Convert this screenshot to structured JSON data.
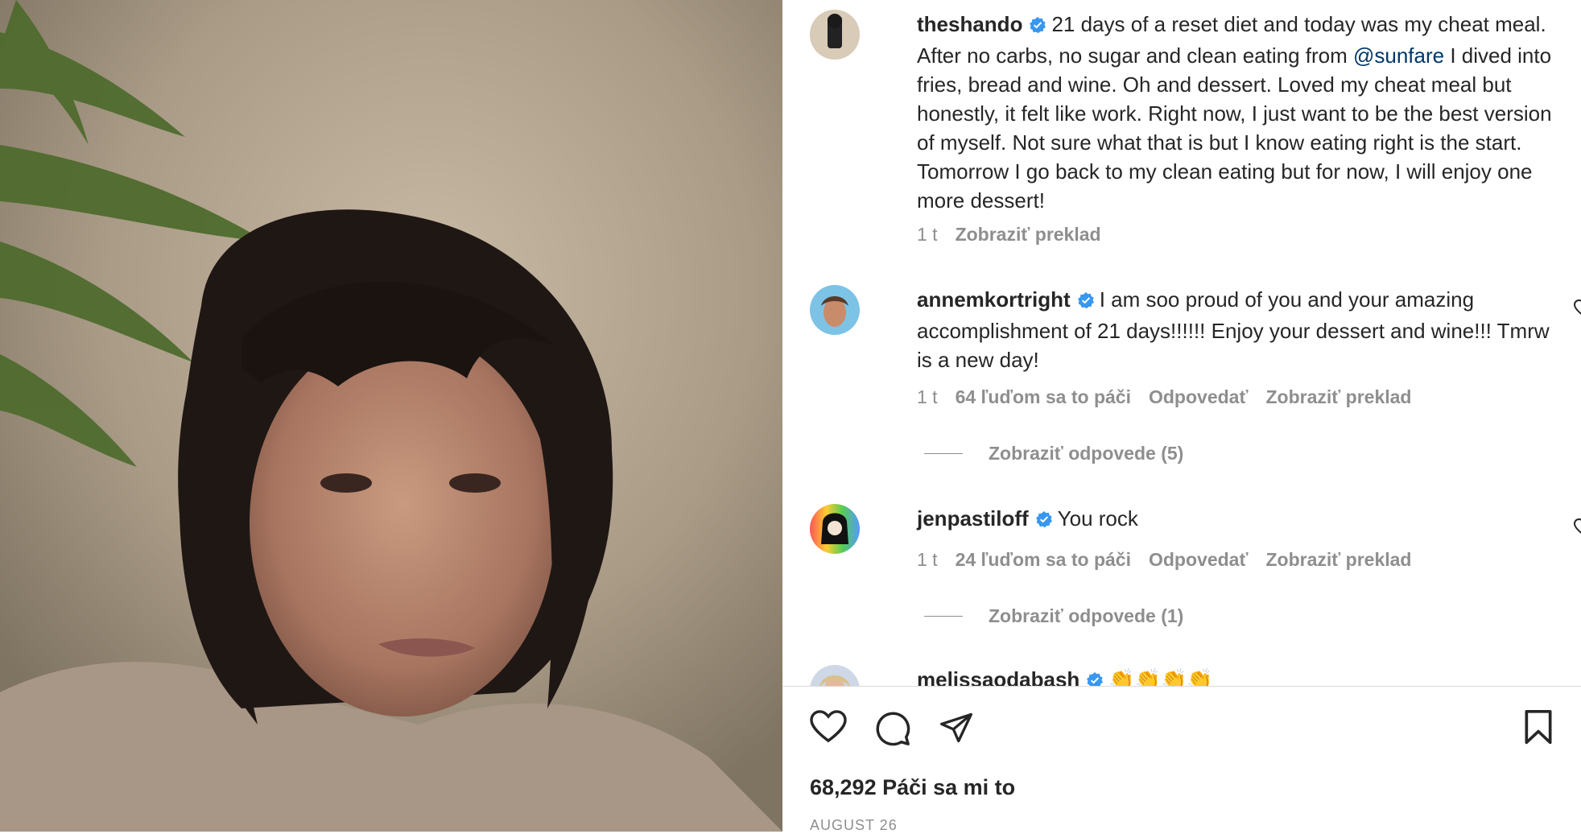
{
  "post": {
    "username": "theshando",
    "caption_text": "21 days of a reset diet and today was my cheat meal. After no carbs, no sugar and clean eating from ",
    "mention": "@sunfare",
    "caption_rest": " I dived into fries, bread and wine. Oh and dessert. Loved my cheat meal but honestly, it felt like work. Right now, I just want to be the best version of myself. Not sure what that is but I know eating right is the start. Tomorrow I go back to my clean eating but for now, I will enjoy one more dessert!",
    "time": "1 t",
    "translate": "Zobraziť preklad"
  },
  "comments": [
    {
      "username": "annemkortright",
      "text": "I am soo proud of you and your amazing accomplishment of 21 days!!!!!! Enjoy your dessert and wine!!! Tmrw is a new day!",
      "time": "1 t",
      "likes": "64 ľuďom sa to páči",
      "reply": "Odpovedať",
      "translate": "Zobraziť preklad",
      "view_replies": "Zobraziť odpovede (5)"
    },
    {
      "username": "jenpastiloff",
      "text": "You rock",
      "time": "1 t",
      "likes": "24 ľuďom sa to páči",
      "reply": "Odpovedať",
      "translate": "Zobraziť preklad",
      "view_replies": "Zobraziť odpovede (1)"
    },
    {
      "username": "melissaodabash",
      "text": "👏👏👏👏"
    }
  ],
  "footer": {
    "likes": "68,292 Páči sa mi to",
    "date": "AUGUST 26"
  },
  "icons": {
    "like": "heart-icon",
    "comment": "comment-icon",
    "share": "share-icon",
    "save": "bookmark-icon",
    "verified": "verified-badge-icon"
  },
  "colors": {
    "verified": "#3897f0",
    "mention": "#00376b",
    "muted": "#8e8e8e",
    "text": "#262626"
  }
}
